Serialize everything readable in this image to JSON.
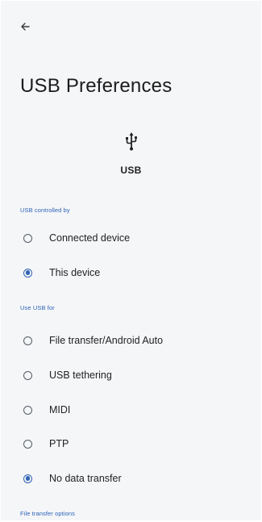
{
  "header": {
    "back_icon": "arrow-back-icon",
    "title": "USB Preferences"
  },
  "usb_summary": {
    "icon": "usb-icon",
    "label": "USB"
  },
  "controlled_by": {
    "header": "USB controlled by",
    "options": [
      {
        "label": "Connected device",
        "selected": false
      },
      {
        "label": "This device",
        "selected": true
      }
    ]
  },
  "use_usb_for": {
    "header": "Use USB for",
    "options": [
      {
        "label": "File transfer/Android Auto",
        "selected": false
      },
      {
        "label": "USB tethering",
        "selected": false
      },
      {
        "label": "MIDI",
        "selected": false
      },
      {
        "label": "PTP",
        "selected": false
      },
      {
        "label": "No data transfer",
        "selected": true
      }
    ]
  },
  "file_transfer_options": {
    "header": "File transfer options"
  },
  "colors": {
    "background": "#f5f6f8",
    "accent": "#2e63b3",
    "text": "#222222"
  }
}
